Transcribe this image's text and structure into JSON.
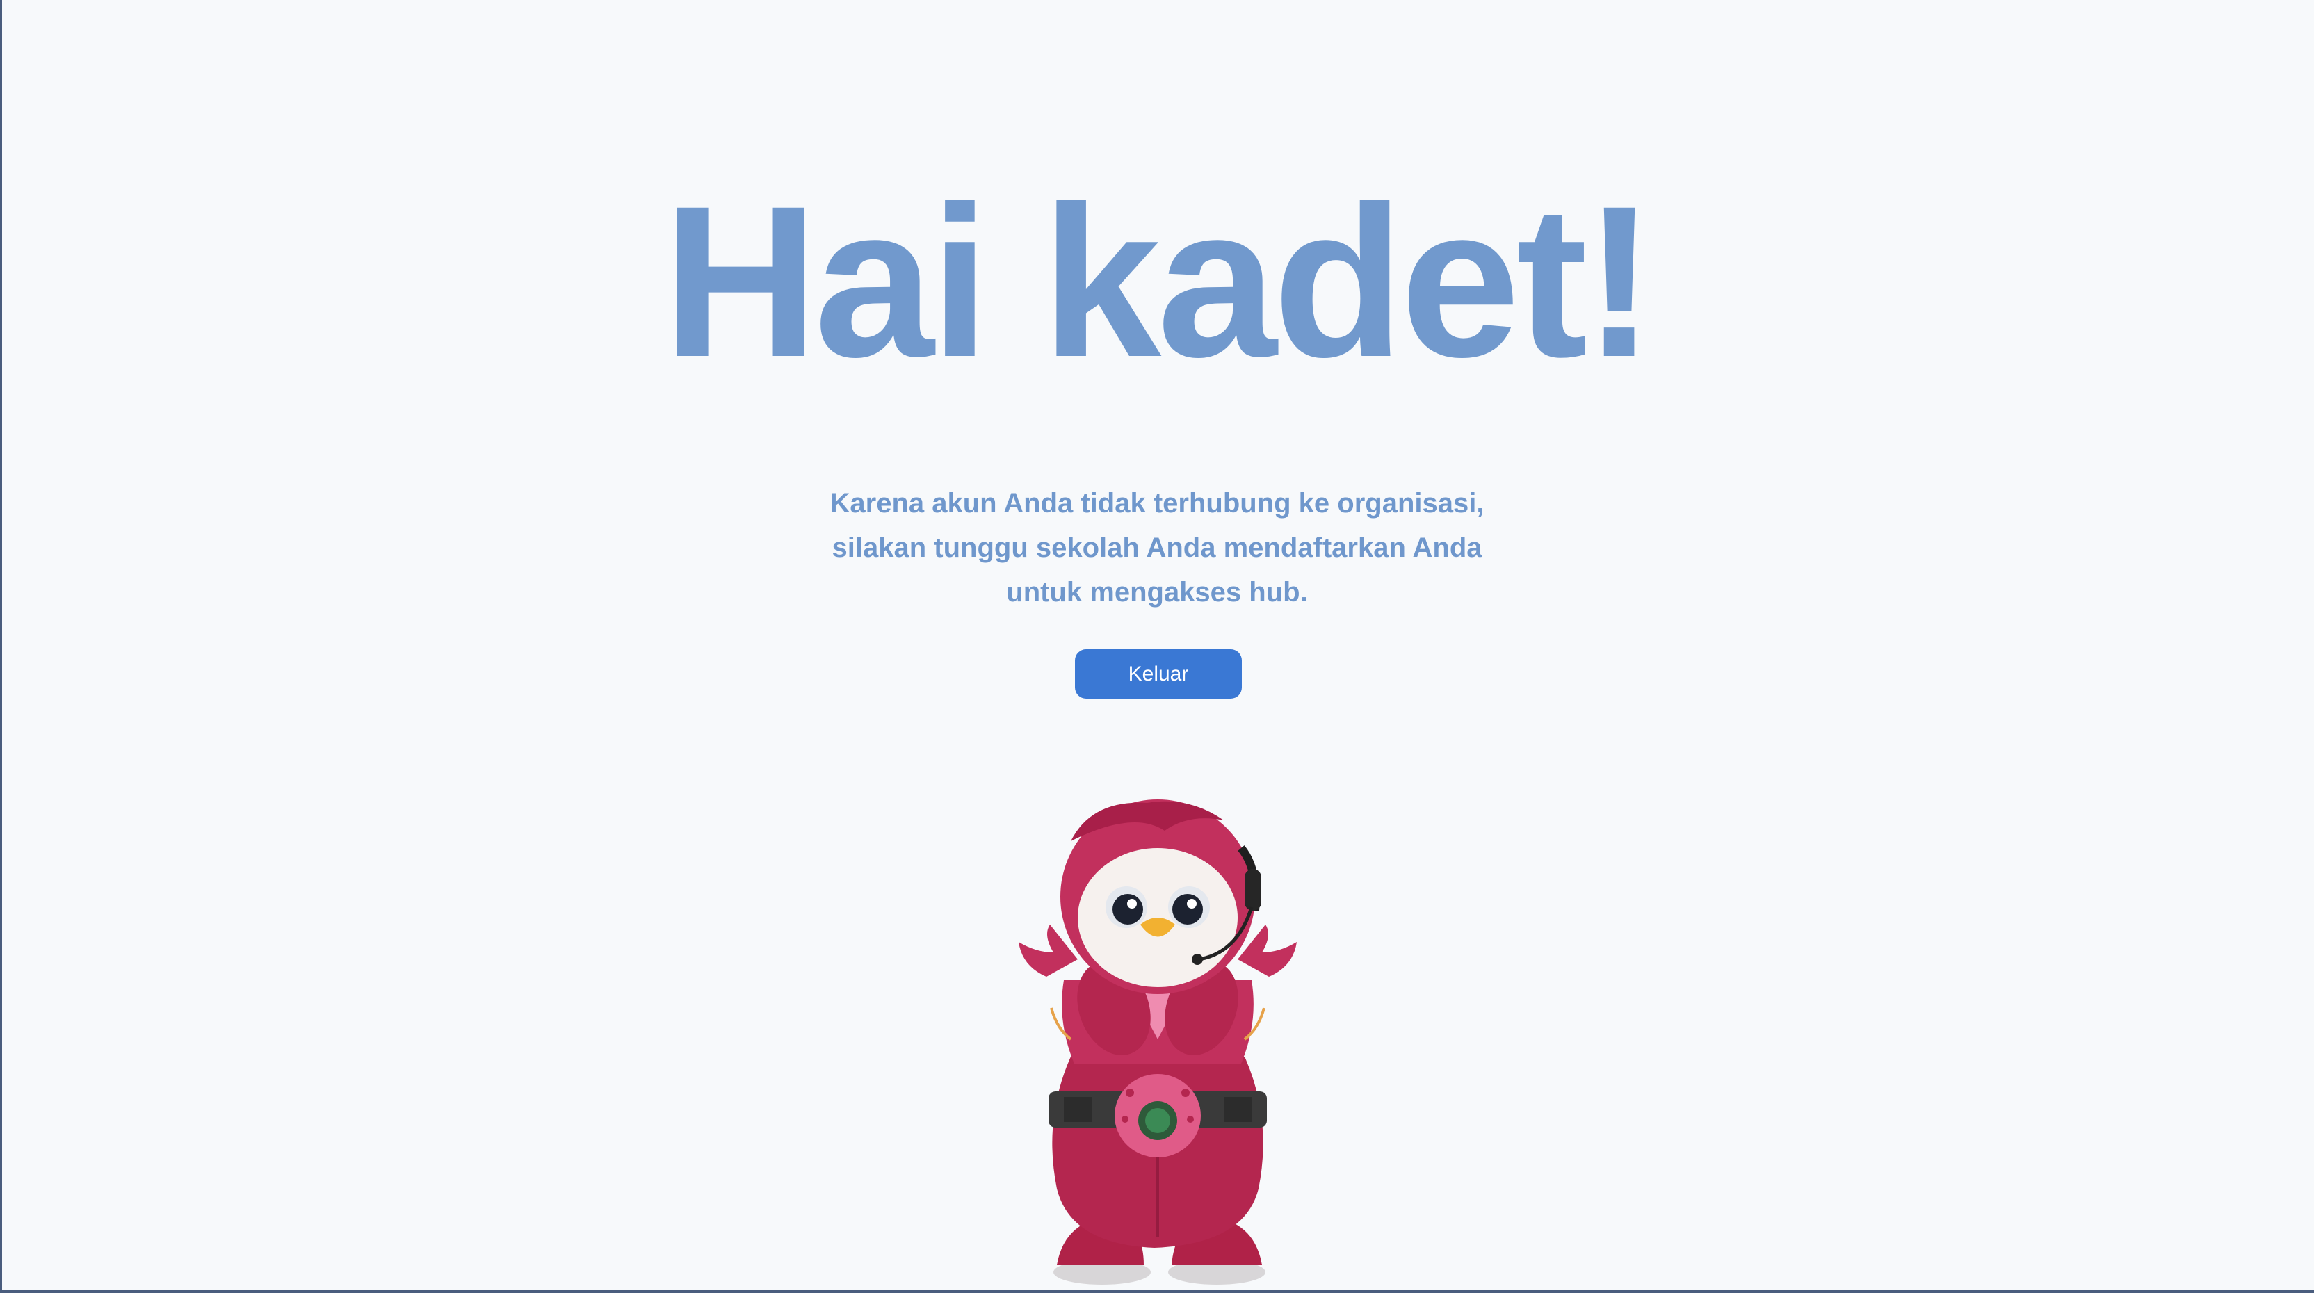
{
  "page": {
    "title": "Hai kadet!",
    "message_lines": [
      "Karena akun Anda tidak terhubung ke organisasi,",
      "silakan tunggu sekolah Anda mendaftarkan Anda",
      "untuk mengakses hub."
    ],
    "logout_label": "Keluar"
  },
  "mascot": {
    "icon": "penguin-mascot-illustration"
  },
  "colors": {
    "background": "#f7f9fb",
    "heading": "#7199cd",
    "button": "#3a78d4",
    "button_text": "#ffffff",
    "mascot_body": "#b4264f"
  }
}
